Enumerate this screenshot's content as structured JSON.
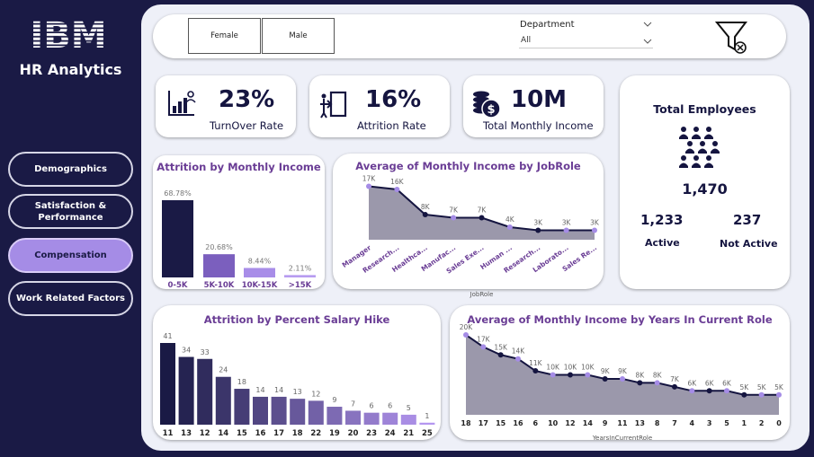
{
  "brand": {
    "logo_text": "IBM",
    "app_title": "HR Analytics"
  },
  "nav": [
    {
      "label": "Demographics",
      "active": false
    },
    {
      "label": "Satisfaction & Performance",
      "active": false
    },
    {
      "label": "Compensation",
      "active": true
    },
    {
      "label": "Work Related Factors",
      "active": false
    }
  ],
  "filters": {
    "gender_buttons": [
      "Female",
      "Male"
    ],
    "department_label": "Department",
    "department_value": "All",
    "clear_icon": "filter-clear-icon"
  },
  "kpis": {
    "turnover": {
      "value": "23%",
      "label": "TurnOver Rate",
      "icon": "chart-person-icon"
    },
    "attrition": {
      "value": "16%",
      "label": "Attrition Rate",
      "icon": "exit-door-icon"
    },
    "income": {
      "value": "10M",
      "label": "Total Monthly Income",
      "icon": "coins-dollar-icon"
    }
  },
  "employees": {
    "title": "Total Employees",
    "total": "1,470",
    "active_value": "1,233",
    "active_label": "Active",
    "not_active_value": "237",
    "not_active_label": "Not Active",
    "icon": "people-group-icon"
  },
  "colors": {
    "dark": "#1a1a45",
    "accent": "#a58ce6",
    "title": "#6a3d95",
    "area": "#9b98ab"
  },
  "chart_data": [
    {
      "id": "attrition_income",
      "type": "bar",
      "title": "Attrition by Monthly Income",
      "categories": [
        "0-5K",
        "5K-10K",
        "10K-15K",
        ">15K"
      ],
      "values": [
        68.78,
        20.68,
        8.44,
        2.11
      ],
      "labels": [
        "68.78%",
        "20.68%",
        "8.44%",
        "2.11%"
      ],
      "colors": [
        "#1a1a45",
        "#7b5fbe",
        "#a88de8",
        "#b79cf0"
      ]
    },
    {
      "id": "income_jobrole",
      "type": "area",
      "title": "Average of Monthly Income by JobRole",
      "xlabel": "JobRole",
      "categories": [
        "Manager",
        "Research...",
        "Healthca...",
        "Manufac...",
        "Sales Exe...",
        "Human ...",
        "Research...",
        "Laborato...",
        "Sales Re..."
      ],
      "values": [
        17,
        16,
        8,
        7,
        7,
        4,
        3,
        3,
        3
      ],
      "labels": [
        "17K",
        "16K",
        "8K",
        "7K",
        "7K",
        "4K",
        "3K",
        "3K",
        "3K"
      ]
    },
    {
      "id": "attrition_hike",
      "type": "bar",
      "title": "Attrition by Percent Salary Hike",
      "categories": [
        "11",
        "13",
        "12",
        "14",
        "15",
        "16",
        "17",
        "18",
        "22",
        "19",
        "20",
        "23",
        "24",
        "21",
        "25"
      ],
      "values": [
        41,
        34,
        33,
        24,
        18,
        14,
        14,
        13,
        12,
        9,
        7,
        6,
        6,
        5,
        1
      ]
    },
    {
      "id": "income_years_role",
      "type": "area",
      "title": "Average of Monthly Income by Years In Current Role",
      "xlabel": "YearsInCurrentRole",
      "categories": [
        "18",
        "17",
        "15",
        "16",
        "6",
        "10",
        "12",
        "14",
        "9",
        "11",
        "13",
        "8",
        "7",
        "4",
        "3",
        "5",
        "1",
        "2",
        "0"
      ],
      "values": [
        20,
        17,
        15,
        14,
        11,
        10,
        10,
        10,
        9,
        9,
        8,
        8,
        7,
        6,
        6,
        6,
        5,
        5,
        5
      ],
      "labels": [
        "20K",
        "17K",
        "15K",
        "14K",
        "11K",
        "10K",
        "10K",
        "10K",
        "9K",
        "9K",
        "8K",
        "8K",
        "7K",
        "6K",
        "6K",
        "6K",
        "5K",
        "5K",
        "5K"
      ]
    }
  ]
}
